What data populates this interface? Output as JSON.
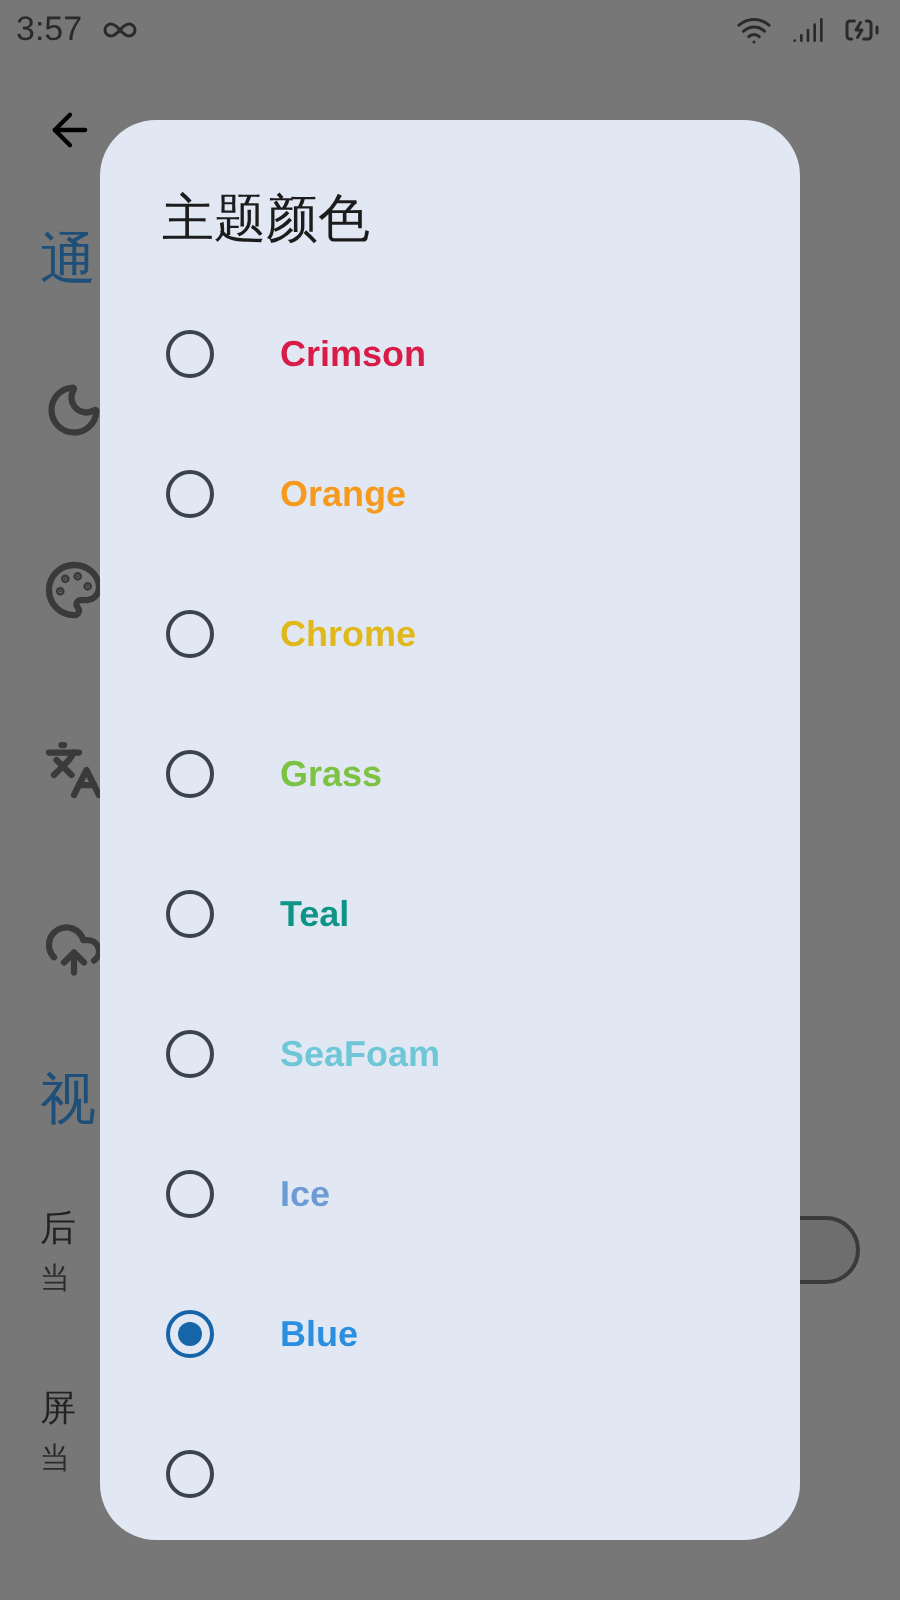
{
  "status_bar": {
    "time": "3:57"
  },
  "background": {
    "sections": [
      {
        "heading": "通",
        "rows": [
          {
            "kind": "icon"
          },
          {
            "kind": "icon"
          },
          {
            "kind": "icon"
          },
          {
            "kind": "icon"
          }
        ]
      },
      {
        "heading": "视",
        "rows": [
          {
            "kind": "switch",
            "title": "后",
            "subtitle": "当",
            "on": false
          },
          {
            "kind": "text",
            "title": "屏",
            "subtitle": "当"
          }
        ]
      }
    ]
  },
  "dialog": {
    "title": "主题颜色",
    "options": [
      {
        "label": "Crimson",
        "color": "#d81b47",
        "selected": false
      },
      {
        "label": "Orange",
        "color": "#f59a1c",
        "selected": false
      },
      {
        "label": "Chrome",
        "color": "#e0b81c",
        "selected": false
      },
      {
        "label": "Grass",
        "color": "#7cc243",
        "selected": false
      },
      {
        "label": "Teal",
        "color": "#0f9488",
        "selected": false
      },
      {
        "label": "SeaFoam",
        "color": "#6ec6d6",
        "selected": false
      },
      {
        "label": "Ice",
        "color": "#6f9bd4",
        "selected": false
      },
      {
        "label": "Blue",
        "color": "#2b8fe0",
        "selected": true
      },
      {
        "selected": false
      }
    ]
  }
}
